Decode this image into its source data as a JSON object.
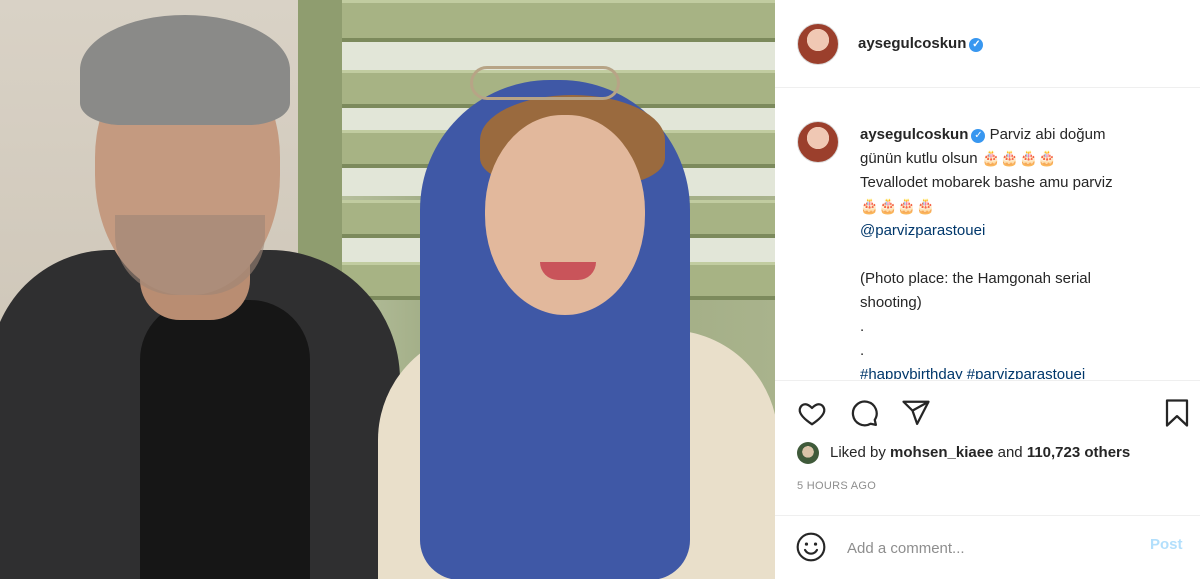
{
  "post": {
    "username": "aysegulcoskun",
    "verified_icon": "verified-badge-icon",
    "caption_lines": [
      "Parviz abi doğum",
      "günün kutlu olsun 🎂🎂🎂🎂",
      "Tevallodet mobarek bashe amu parviz",
      "🎂🎂🎂🎂",
      "@parvizparastouei",
      "",
      "(Photo place: the Hamgonah serial",
      "shooting)",
      ".",
      ".",
      "#happybirthday #parvizparastouei"
    ],
    "likes": {
      "prefix": "Liked by ",
      "user": "mohsen_kiaee",
      "middle": " and ",
      "count": "110,723 others"
    },
    "time_ago": "5 HOURS AGO",
    "comment_placeholder": "Add a comment...",
    "post_label": "Post"
  },
  "icons": {
    "like": "heart-icon",
    "comment": "comment-icon",
    "share": "share-icon",
    "save": "bookmark-icon",
    "emoji": "emoji-icon"
  },
  "colors": {
    "verified": "#3897f0",
    "link": "#00376b",
    "post_disabled": "#b2dffc",
    "muted": "#8e8e8e"
  }
}
